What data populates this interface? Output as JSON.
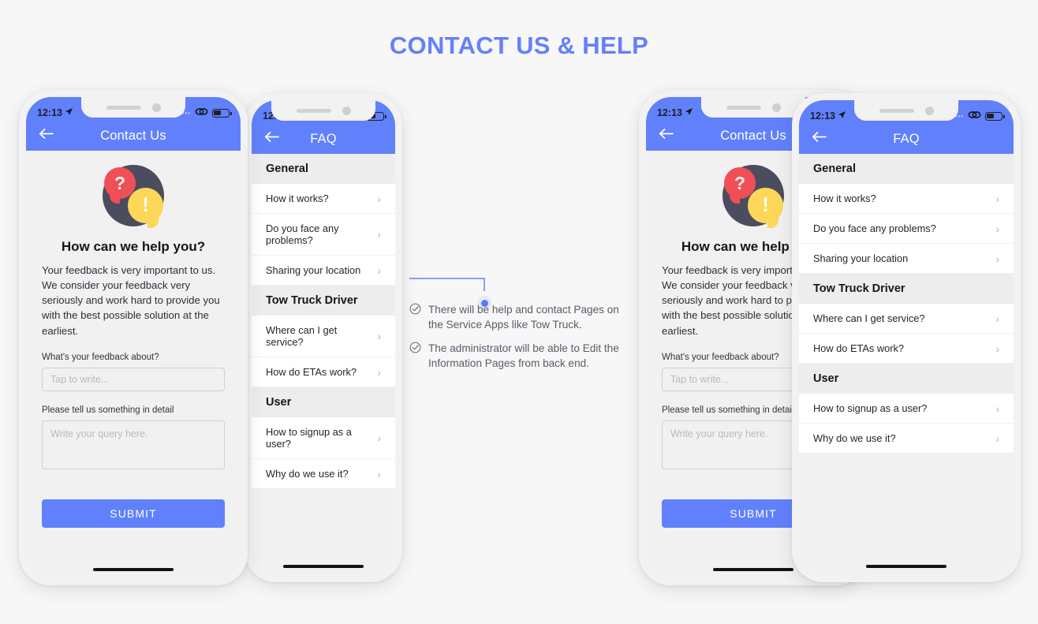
{
  "page": {
    "title": "CONTACT US & HELP",
    "accent": "#6180fb",
    "background": "#f7f7f8"
  },
  "status_bar": {
    "time": "12:13",
    "location_icon": "location-arrow-icon",
    "signal_icon": "signal-dots-icon",
    "wifi_icon": "wifi-icon",
    "battery_icon": "battery-icon"
  },
  "contact_screen": {
    "appbar": {
      "back_icon": "back-arrow-icon",
      "title": "Contact Us"
    },
    "illustration": {
      "name": "help-bubbles-icon",
      "question_mark": "?",
      "exclamation_mark": "!",
      "disc_color": "#4b4d5e",
      "question_color": "#f04f57",
      "exclamation_color": "#fcd75a"
    },
    "heading": "How can we help you?",
    "paragraph": "Your feedback is very important to us. We consider your feedback very seriously and work hard to provide you with the best possible solution at the earliest.",
    "subject_label": "What's your feedback about?",
    "subject_placeholder": "Tap to write...",
    "detail_label": "Please tell us something in detail",
    "detail_placeholder": "Write your query here.",
    "submit_label": "SUBMIT"
  },
  "faq_screen": {
    "appbar": {
      "back_icon": "back-arrow-icon",
      "title": "FAQ"
    },
    "sections": [
      {
        "title": "General",
        "items": [
          "How it works?",
          "Do you face any problems?",
          "Sharing your location"
        ]
      },
      {
        "title": "Tow Truck Driver",
        "items": [
          "Where can I get service?",
          "How do ETAs work?"
        ]
      },
      {
        "title": "User",
        "items": [
          "How to signup as a user?",
          "Why do we use it?"
        ]
      }
    ],
    "chevron_icon": "chevron-right-icon"
  },
  "annotations": {
    "check_icon": "check-circle-icon",
    "items": [
      "There will be help and contact Pages on the Service Apps like Tow Truck.",
      "The administrator will be able to Edit the Information Pages from back end."
    ]
  }
}
